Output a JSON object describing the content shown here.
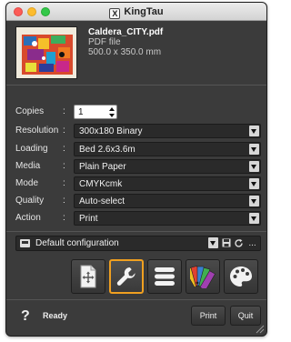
{
  "window": {
    "title": "KingTau"
  },
  "file": {
    "name": "Caldera_CITY.pdf",
    "type": "PDF file",
    "size": "500.0 x 350.0 mm"
  },
  "settings": {
    "copies": {
      "label": "Copies",
      "value": "1"
    },
    "resolution": {
      "label": "Resolution",
      "value": "300x180 Binary"
    },
    "loading": {
      "label": "Loading",
      "value": "Bed 2.6x3.6m"
    },
    "media": {
      "label": "Media",
      "value": "Plain Paper"
    },
    "mode": {
      "label": "Mode",
      "value": "CMYKcmk"
    },
    "quality": {
      "label": "Quality",
      "value": "Auto-select"
    },
    "action": {
      "label": "Action",
      "value": "Print"
    },
    "separator": ":"
  },
  "configuration": {
    "value": "Default configuration",
    "more": "..."
  },
  "toolbar": {
    "active": "tools-icon",
    "icons": [
      "crop-move-icon",
      "tools-icon",
      "list-icon",
      "swatches-icon",
      "palette-icon"
    ]
  },
  "footer": {
    "help": "?",
    "status": "Ready",
    "print_label": "Print",
    "quit_label": "Quit"
  },
  "colors": {
    "accent": "#f0a020",
    "panel": "#3b3b3b",
    "field": "#2a2a2a"
  }
}
